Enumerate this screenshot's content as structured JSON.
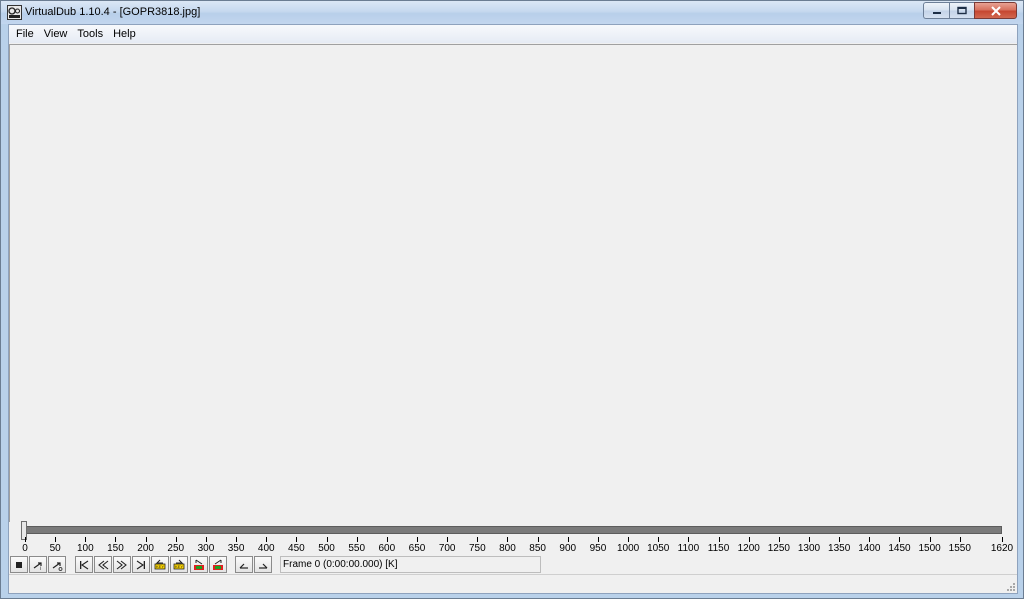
{
  "window": {
    "title": "VirtualDub 1.10.4 - [GOPR3818.jpg]"
  },
  "menu": [
    "File",
    "View",
    "Tools",
    "Help"
  ],
  "timeline": {
    "position_frame": 0,
    "max_frame": 1620,
    "tick_labels": [
      "0",
      "50",
      "100",
      "150",
      "200",
      "250",
      "300",
      "350",
      "400",
      "450",
      "500",
      "550",
      "600",
      "650",
      "700",
      "750",
      "800",
      "850",
      "900",
      "950",
      "1000",
      "1050",
      "1100",
      "1150",
      "1200",
      "1250",
      "1300",
      "1350",
      "1400",
      "1450",
      "1500",
      "1550",
      "1620"
    ]
  },
  "toolbar": {
    "buttons": [
      {
        "name": "stop-icon"
      },
      {
        "name": "play-input-icon"
      },
      {
        "name": "play-output-icon"
      },
      {
        "name": "go-to-start-icon"
      },
      {
        "name": "step-backward-icon"
      },
      {
        "name": "step-forward-icon"
      },
      {
        "name": "go-to-end-icon"
      },
      {
        "name": "previous-keyframe-icon"
      },
      {
        "name": "next-keyframe-icon"
      },
      {
        "name": "previous-scene-icon"
      },
      {
        "name": "next-scene-icon"
      },
      {
        "name": "mark-in-icon"
      },
      {
        "name": "mark-out-icon"
      }
    ],
    "frame_status": "Frame 0 (0:00:00.000) [K]"
  },
  "colors": {
    "title_bar": "#c6d9ef",
    "client_bg": "#f0f0f0",
    "close_button": "#c64731",
    "track": "#7a7a7a"
  }
}
